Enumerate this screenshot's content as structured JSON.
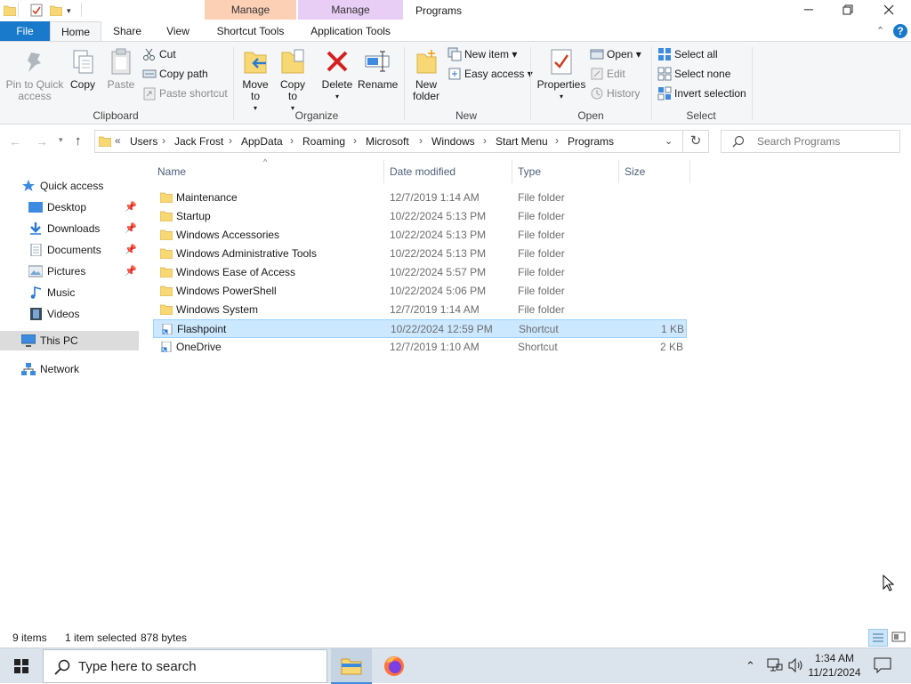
{
  "window": {
    "title": "Programs",
    "context_tabs": [
      {
        "label": "Manage",
        "color": "#fbd0b5",
        "group": "Shortcut Tools"
      },
      {
        "label": "Manage",
        "color": "#e8cdf5",
        "group": "Application Tools"
      }
    ]
  },
  "ribbon_tabs": [
    "File",
    "Home",
    "Share",
    "View",
    "Shortcut Tools",
    "Application Tools"
  ],
  "ribbon": {
    "clipboard": {
      "pin_label": "Pin to Quick access",
      "copy_label": "Copy",
      "paste_label": "Paste",
      "cut_label": "Cut",
      "copy_path_label": "Copy path",
      "paste_shortcut_label": "Paste shortcut",
      "group_label": "Clipboard"
    },
    "organize": {
      "move_label": "Move to",
      "copy_to_label": "Copy to",
      "delete_label": "Delete",
      "rename_label": "Rename",
      "group_label": "Organize"
    },
    "new": {
      "new_folder_label": "New folder",
      "new_item_label": "New item",
      "easy_access_label": "Easy access",
      "group_label": "New"
    },
    "open": {
      "properties_label": "Properties",
      "open_label": "Open",
      "edit_label": "Edit",
      "history_label": "History",
      "group_label": "Open"
    },
    "select": {
      "select_all_label": "Select all",
      "select_none_label": "Select none",
      "invert_label": "Invert selection",
      "group_label": "Select"
    }
  },
  "address": {
    "overflow": "«",
    "breadcrumbs": [
      "Users",
      "Jack Frost",
      "AppData",
      "Roaming",
      "Microsoft",
      "Windows",
      "Start Menu",
      "Programs"
    ],
    "search_placeholder": "Search Programs"
  },
  "nav": {
    "quick_access": "Quick access",
    "items": [
      "Desktop",
      "Downloads",
      "Documents",
      "Pictures",
      "Music",
      "Videos"
    ],
    "this_pc": "This PC",
    "network": "Network"
  },
  "columns": [
    "Name",
    "Date modified",
    "Type",
    "Size"
  ],
  "files": [
    {
      "name": "Maintenance",
      "date": "12/7/2019 1:14 AM",
      "type": "File folder",
      "size": ""
    },
    {
      "name": "Startup",
      "date": "10/22/2024 5:13 PM",
      "type": "File folder",
      "size": ""
    },
    {
      "name": "Windows Accessories",
      "date": "10/22/2024 5:13 PM",
      "type": "File folder",
      "size": ""
    },
    {
      "name": "Windows Administrative Tools",
      "date": "10/22/2024 5:13 PM",
      "type": "File folder",
      "size": ""
    },
    {
      "name": "Windows Ease of Access",
      "date": "10/22/2024 5:57 PM",
      "type": "File folder",
      "size": ""
    },
    {
      "name": "Windows PowerShell",
      "date": "10/22/2024 5:06 PM",
      "type": "File folder",
      "size": ""
    },
    {
      "name": "Windows System",
      "date": "12/7/2019 1:14 AM",
      "type": "File folder",
      "size": ""
    },
    {
      "name": "Flashpoint",
      "date": "10/22/2024 12:59 PM",
      "type": "Shortcut",
      "size": "1 KB",
      "selected": true
    },
    {
      "name": "OneDrive",
      "date": "12/7/2019 1:10 AM",
      "type": "Shortcut",
      "size": "2 KB"
    }
  ],
  "status": {
    "items_count": "9 items",
    "selection": "1 item selected",
    "selection_size": "878 bytes"
  },
  "taskbar": {
    "search_placeholder": "Type here to search",
    "time": "1:34 AM",
    "date": "11/21/2024"
  }
}
